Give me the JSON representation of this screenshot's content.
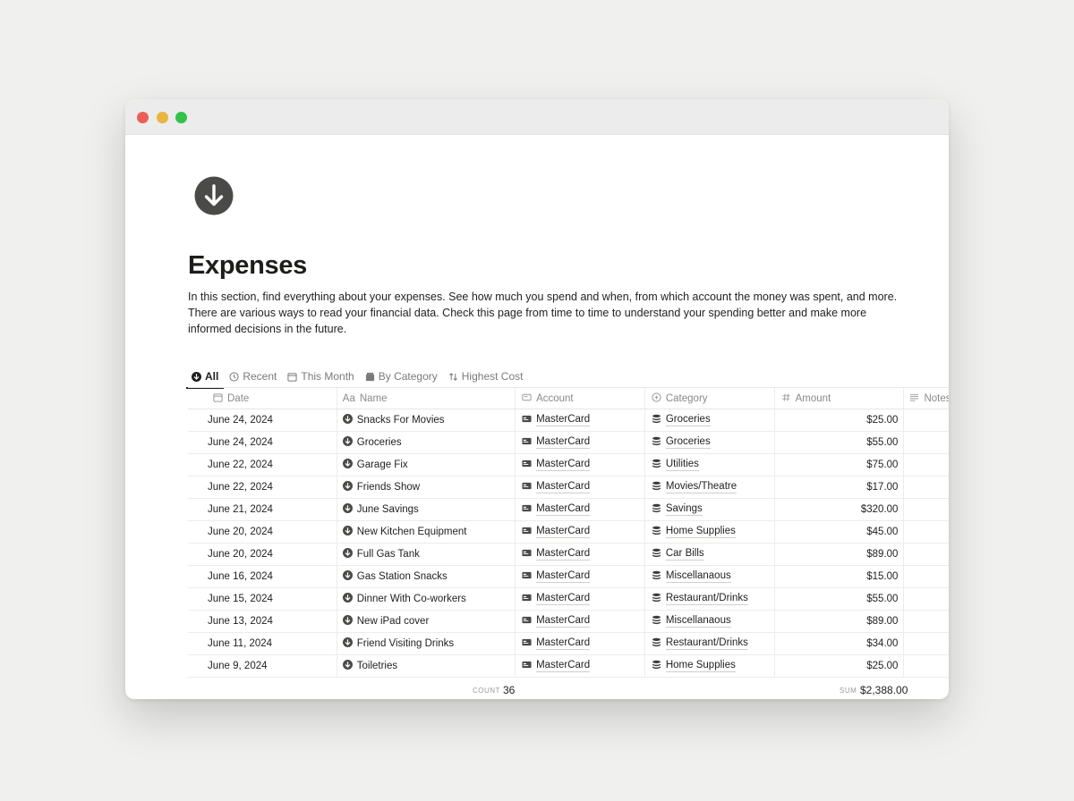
{
  "page": {
    "icon": "arrow-down-circle-icon",
    "title": "Expenses",
    "description": "In this section, find everything about your expenses. See how much you spend and when, from which account the money was spent, and more. There are various ways to read your financial data. Check this page from time to time to understand your spending better and make more informed decisions in the future."
  },
  "tabs": [
    {
      "label": "All",
      "icon": "arrow-down-circle-icon",
      "active": true
    },
    {
      "label": "Recent",
      "icon": "clock-icon",
      "active": false
    },
    {
      "label": "This Month",
      "icon": "calendar-icon",
      "active": false
    },
    {
      "label": "By Category",
      "icon": "folder-icon",
      "active": false
    },
    {
      "label": "Highest Cost",
      "icon": "sort-icon",
      "active": false
    }
  ],
  "columns": {
    "date": "Date",
    "name": "Name",
    "name_prefix": "Aa",
    "account": "Account",
    "category": "Category",
    "amount": "Amount",
    "notes": "Notes"
  },
  "rows": [
    {
      "date": "June 24, 2024",
      "name": "Snacks For Movies",
      "account": "MasterCard",
      "category": "Groceries",
      "amount": "$25.00"
    },
    {
      "date": "June 24, 2024",
      "name": "Groceries",
      "account": "MasterCard",
      "category": "Groceries",
      "amount": "$55.00"
    },
    {
      "date": "June 22, 2024",
      "name": "Garage Fix",
      "account": "MasterCard",
      "category": "Utilities",
      "amount": "$75.00"
    },
    {
      "date": "June 22, 2024",
      "name": "Friends Show",
      "account": "MasterCard",
      "category": "Movies/Theatre",
      "amount": "$17.00"
    },
    {
      "date": "June 21, 2024",
      "name": "June Savings",
      "account": "MasterCard",
      "category": "Savings",
      "amount": "$320.00"
    },
    {
      "date": "June 20, 2024",
      "name": "New Kitchen Equipment",
      "account": "MasterCard",
      "category": "Home Supplies",
      "amount": "$45.00"
    },
    {
      "date": "June 20, 2024",
      "name": "Full Gas Tank",
      "account": "MasterCard",
      "category": "Car Bills",
      "amount": "$89.00"
    },
    {
      "date": "June 16, 2024",
      "name": "Gas Station Snacks",
      "account": "MasterCard",
      "category": "Miscellanaous",
      "amount": "$15.00"
    },
    {
      "date": "June 15, 2024",
      "name": "Dinner With Co-workers",
      "account": "MasterCard",
      "category": "Restaurant/Drinks",
      "amount": "$55.00"
    },
    {
      "date": "June 13, 2024",
      "name": "New iPad cover",
      "account": "MasterCard",
      "category": "Miscellanaous",
      "amount": "$89.00"
    },
    {
      "date": "June 11, 2024",
      "name": "Friend Visiting Drinks",
      "account": "MasterCard",
      "category": "Restaurant/Drinks",
      "amount": "$34.00"
    },
    {
      "date": "June 9, 2024",
      "name": "Toiletries",
      "account": "MasterCard",
      "category": "Home Supplies",
      "amount": "$25.00"
    }
  ],
  "footer": {
    "count_label": "COUNT",
    "count_value": "36",
    "sum_label": "SUM",
    "sum_value": "$2,388.00"
  },
  "colors": {
    "window_bg": "#ffffff",
    "page_bg": "#f0f0ee",
    "icon_dark": "#4a4a48",
    "traffic_red": "#ec5f57",
    "traffic_yellow": "#e9b53d",
    "traffic_green": "#33c24a"
  }
}
